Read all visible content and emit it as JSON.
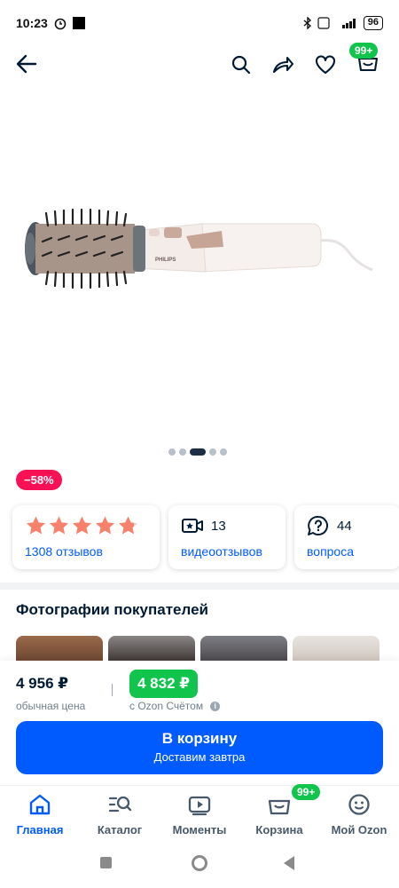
{
  "status_bar": {
    "time": "10:23",
    "battery": "96"
  },
  "product": {
    "discount": "−58%",
    "slide_count": 5,
    "active_slide": 3
  },
  "stats": {
    "rating_stars": 4.8,
    "reviews": "1308 отзывов",
    "video_count": "13",
    "video_label": "видеоотзывов",
    "questions_count": "44",
    "questions_label": "вопроса"
  },
  "photos": {
    "title": "Фотографии покупателей"
  },
  "price": {
    "old": "4 956 ₽",
    "old_label": "обычная цена",
    "new": "4 832 ₽",
    "new_label": "с Ozon Счётом",
    "info_icon": "i"
  },
  "cart_button": {
    "title": "В корзину",
    "subtitle": "Доставим завтра"
  },
  "header": {
    "cart_badge": "99+"
  },
  "tabbar": {
    "items": [
      {
        "label": "Главная",
        "icon": "home-icon"
      },
      {
        "label": "Каталог",
        "icon": "catalog-search-icon"
      },
      {
        "label": "Моменты",
        "icon": "moments-icon"
      },
      {
        "label": "Корзина",
        "icon": "cart-icon",
        "badge": "99+"
      },
      {
        "label": "Мой Ozon",
        "icon": "profile-icon"
      }
    ]
  },
  "colors": {
    "accent": "#005bff",
    "green": "#10c44c",
    "discount": "#f91155",
    "star": "#f7816b"
  }
}
